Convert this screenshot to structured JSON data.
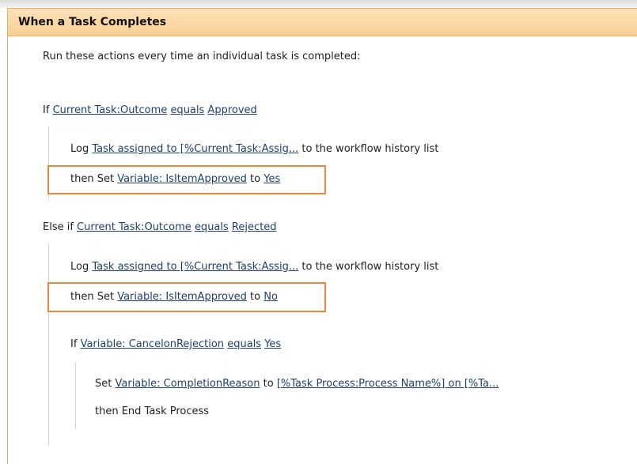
{
  "header": {
    "title": "When a Task Completes"
  },
  "description": "Run these actions every time an individual task is completed:",
  "if_block": {
    "keyword": "If",
    "field": "Current Task:Outcome",
    "operator": "equals",
    "value": "Approved",
    "log": {
      "prefix": "Log",
      "message": "Task assigned to [%Current Task:Assig...",
      "suffix": "to the workflow history list"
    },
    "set": {
      "prefix": "then Set",
      "variable": "Variable: IsItemApproved",
      "to": "to",
      "value": "Yes"
    }
  },
  "else_if_block": {
    "keyword": "Else if",
    "field": "Current Task:Outcome",
    "operator": "equals",
    "value": "Rejected",
    "log": {
      "prefix": "Log",
      "message": "Task assigned to [%Current Task:Assig...",
      "suffix": "to the workflow history list"
    },
    "set": {
      "prefix": "then Set",
      "variable": "Variable: IsItemApproved",
      "to": "to",
      "value": "No"
    },
    "nested_if": {
      "keyword": "If",
      "field": "Variable: CancelonRejection",
      "operator": "equals",
      "value": "Yes",
      "set": {
        "prefix": "Set",
        "variable": "Variable: CompletionReason",
        "to": "to",
        "value": "[%Task Process:Process Name%] on [%Ta..."
      },
      "end": "then End Task Process"
    }
  },
  "colors": {
    "header_bg": "#fbd9a6",
    "highlight": "#e8893a",
    "link": "#1f3f70"
  }
}
